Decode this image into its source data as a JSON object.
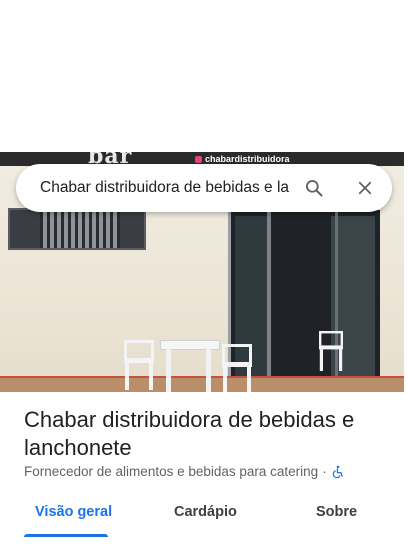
{
  "photo": {
    "sign_text": "bar",
    "instagram_handle": "chabardistribuidora",
    "accent_colors": {
      "sign": "#2b2b2b",
      "stripe": "#c94f3a"
    }
  },
  "search": {
    "value": "Chabar distribuidora de bebidas e la",
    "search_icon": "search-icon",
    "close_icon": "close-icon"
  },
  "place": {
    "title": "Chabar distribuidora de bebidas e lanchonete",
    "category": "Fornecedor de alimentos e bebidas para catering",
    "separator": "·",
    "accessibility_icon": "wheelchair-icon"
  },
  "tabs": [
    {
      "label": "Visão geral",
      "active": true
    },
    {
      "label": "Cardápio",
      "active": false
    },
    {
      "label": "Sobre",
      "active": false
    }
  ],
  "colors": {
    "accent": "#1a73e8",
    "title": "#202124",
    "secondary": "#5f6368"
  }
}
